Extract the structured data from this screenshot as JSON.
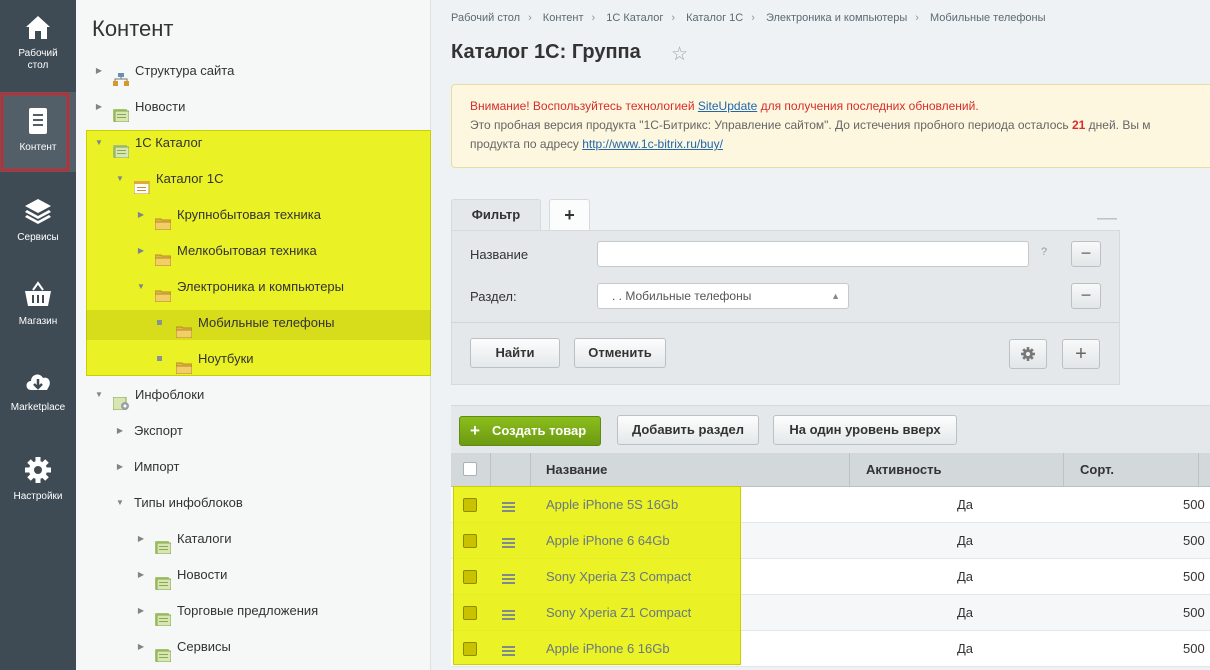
{
  "leftbar": {
    "items": [
      {
        "label": "Рабочий стол",
        "icon": "home-icon"
      },
      {
        "label": "Контент",
        "icon": "document-icon"
      },
      {
        "label": "Сервисы",
        "icon": "layers-icon"
      },
      {
        "label": "Магазин",
        "icon": "basket-icon"
      },
      {
        "label": "Marketplace",
        "icon": "cloud-download-icon"
      },
      {
        "label": "Настройки",
        "icon": "gear-icon"
      }
    ]
  },
  "tree": {
    "title": "Контент",
    "nodes": [
      {
        "label": "Структура сайта",
        "icon": "site-structure-icon"
      },
      {
        "label": "Новости",
        "icon": "iblock-icon"
      },
      {
        "label": "1С Каталог",
        "icon": "iblock-icon"
      },
      {
        "label": "Каталог 1С",
        "icon": "catalog-icon"
      },
      {
        "label": "Крупнобытовая техника",
        "icon": "folder-icon"
      },
      {
        "label": "Мелкобытовая техника",
        "icon": "folder-icon"
      },
      {
        "label": "Электроника и компьютеры",
        "icon": "folder-icon"
      },
      {
        "label": "Мобильные телефоны",
        "icon": "folder-icon"
      },
      {
        "label": "Ноутбуки",
        "icon": "folder-icon"
      },
      {
        "label": "Инфоблоки",
        "icon": "iblock-gear-icon"
      },
      {
        "label": "Экспорт"
      },
      {
        "label": "Импорт"
      },
      {
        "label": "Типы инфоблоков"
      },
      {
        "label": "Каталоги",
        "icon": "iblock-icon"
      },
      {
        "label": "Новости",
        "icon": "iblock-icon"
      },
      {
        "label": "Торговые предложения",
        "icon": "iblock-icon"
      },
      {
        "label": "Сервисы",
        "icon": "iblock-icon"
      }
    ]
  },
  "breadcrumbs": [
    "Рабочий стол",
    "Контент",
    "1С Каталог",
    "Каталог 1С",
    "Электроника и компьютеры",
    "Мобильные телефоны"
  ],
  "page": {
    "title": "Каталог 1С: Группа"
  },
  "notice": {
    "warn_prefix": "Внимание! Воспользуйтесь технологией ",
    "warn_link": "SiteUpdate",
    "warn_suffix": " для получения последних обновлений.",
    "line2_prefix": "Это пробная версия продукта \"1С-Битрикс: Управление сайтом\". До истечения пробного периода осталось ",
    "days": "21",
    "line2_suffix": " дней. Вы м",
    "line3_prefix": "продукта по адресу ",
    "line3_link": "http://www.1c-bitrix.ru/buy/"
  },
  "filter": {
    "tab_label": "Фильтр",
    "add_tab": "+",
    "name_label": "Название",
    "name_value": "",
    "help": "?",
    "section_label": "Раздел:",
    "section_value": ". . Мобильные телефоны",
    "find_label": "Найти",
    "cancel_label": "Отменить"
  },
  "toolbar": {
    "create_label": "Создать товар",
    "add_section_label": "Добавить раздел",
    "up_label": "На один уровень вверх"
  },
  "table": {
    "columns": [
      "Название",
      "Активность",
      "Сорт."
    ],
    "rows": [
      {
        "name": "Apple iPhone 5S 16Gb",
        "active": "Да",
        "sort": "500"
      },
      {
        "name": "Apple iPhone 6 64Gb",
        "active": "Да",
        "sort": "500"
      },
      {
        "name": "Sony Xperia Z3 Compact",
        "active": "Да",
        "sort": "500"
      },
      {
        "name": "Sony Xperia Z1 Compact",
        "active": "Да",
        "sort": "500"
      },
      {
        "name": "Apple iPhone 6 16Gb",
        "active": "Да",
        "sort": "500"
      }
    ]
  },
  "colors": {
    "highlight": "#e8f000",
    "active_border": "#e01e24",
    "green_button": "#7aab17"
  }
}
